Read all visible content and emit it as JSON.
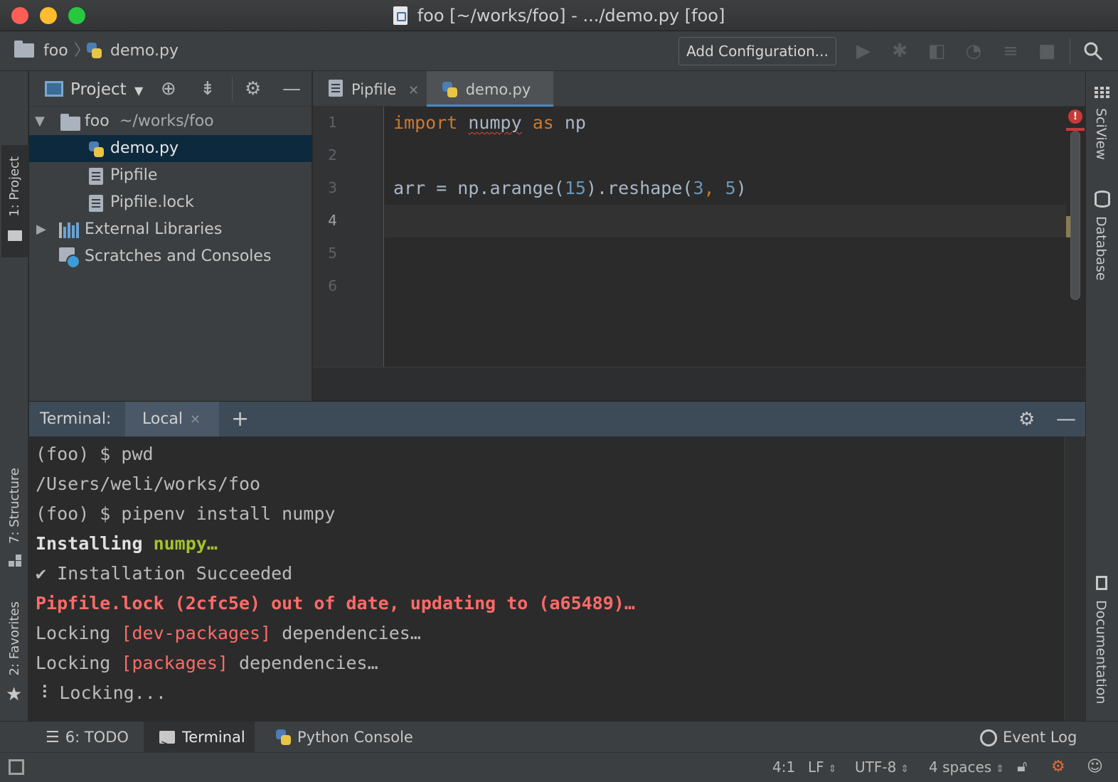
{
  "window": {
    "title": "foo [~/works/foo] - .../demo.py [foo]",
    "traffic_colors": [
      "#fd5f57",
      "#febc2e",
      "#27c840"
    ]
  },
  "navbar": {
    "breadcrumb_project": "foo",
    "breadcrumb_file": "demo.py",
    "add_configuration": "Add Configuration..."
  },
  "left_stripe": {
    "project_tab": "1: Project",
    "structure_tab": "7: Structure",
    "favorites_tab": "2: Favorites"
  },
  "right_stripe": {
    "sciview_tab": "SciView",
    "database_tab": "Database",
    "documentation_tab": "Documentation"
  },
  "project_panel": {
    "title": "Project",
    "tree": [
      {
        "label": "foo",
        "detail": "~/works/foo"
      },
      {
        "label": "demo.py"
      },
      {
        "label": "Pipfile"
      },
      {
        "label": "Pipfile.lock"
      },
      {
        "label": "External Libraries"
      },
      {
        "label": "Scratches and Consoles"
      }
    ]
  },
  "editor": {
    "tabs": [
      {
        "label": "Pipfile"
      },
      {
        "label": "demo.py"
      }
    ],
    "line_numbers": [
      "1",
      "2",
      "3",
      "4",
      "5",
      "6"
    ],
    "code": {
      "line1": {
        "kw_import": "import",
        "module": "numpy",
        "kw_as": "as",
        "alias": "np"
      },
      "line3": {
        "a": "arr = np.arange(",
        "n1": "15",
        "b": ").reshape(",
        "n2": "3",
        "c": ", ",
        "n3": "5",
        "d": ")"
      }
    },
    "error_badge": "!"
  },
  "terminal": {
    "label": "Terminal:",
    "tab": "Local",
    "lines": {
      "l1": "(foo) $ pwd",
      "l2": "/Users/weli/works/foo",
      "l3": "(foo) $ pipenv install numpy",
      "l4_a": "Installing ",
      "l4_b": "numpy…",
      "l5": "✔ Installation Succeeded",
      "l6": "Pipfile.lock (2cfc5e) out of date, updating to (a65489)…",
      "l7_a": "Locking ",
      "l7_b": "[dev-packages]",
      "l7_c": " dependencies…",
      "l8_a": "Locking ",
      "l8_b": "[packages]",
      "l8_c": " dependencies…",
      "l9": "⠸ Locking..."
    }
  },
  "bottom_bar": {
    "todo": "6: TODO",
    "terminal": "Terminal",
    "python_console": "Python Console",
    "event_log": "Event Log"
  },
  "status_bar": {
    "position": "4:1",
    "line_sep": "LF",
    "encoding": "UTF-8",
    "indent": "4 spaces"
  }
}
